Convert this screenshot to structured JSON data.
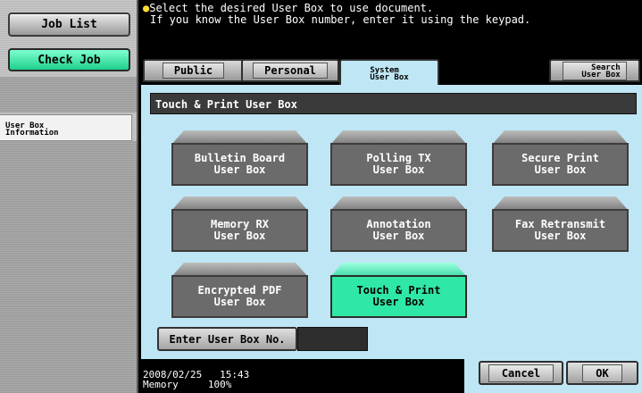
{
  "left_panel": {
    "job_list_label": "Job List",
    "check_job_label": "Check Job",
    "user_box_info_line1": "User Box",
    "user_box_info_line2": "Information"
  },
  "message": {
    "line1": "Select the desired User Box to use document.",
    "line2": "If you know the User Box number, enter it using the keypad."
  },
  "tabs": {
    "public": "Public",
    "personal": "Personal",
    "system_line1": "System",
    "system_line2": "User Box",
    "search_line1": "Search",
    "search_line2": "User Box"
  },
  "section_title": "Touch & Print User Box",
  "boxes": [
    {
      "line1": "Bulletin Board",
      "line2": "User Box"
    },
    {
      "line1": "Polling TX",
      "line2": "User Box"
    },
    {
      "line1": "Secure Print",
      "line2": "User Box"
    },
    {
      "line1": "Memory RX",
      "line2": "User Box"
    },
    {
      "line1": "Annotation",
      "line2": "User Box"
    },
    {
      "line1": "Fax Retransmit",
      "line2": "User Box"
    },
    {
      "line1": "Encrypted PDF",
      "line2": "User Box"
    },
    {
      "line1": "Touch & Print",
      "line2": "User Box",
      "selected": true
    }
  ],
  "enter_box_no_label": "Enter User Box No.",
  "enter_box_no_value": "",
  "status": {
    "date": "2008/02/25",
    "time": "15:43",
    "memory_label": "Memory",
    "memory_value": "100%"
  },
  "actions": {
    "cancel_label": "Cancel",
    "ok_label": "OK"
  },
  "colors": {
    "accent_selected": "#2fe8a6",
    "content_background": "#bfe6f4",
    "box_button": "#6b6b6b"
  }
}
